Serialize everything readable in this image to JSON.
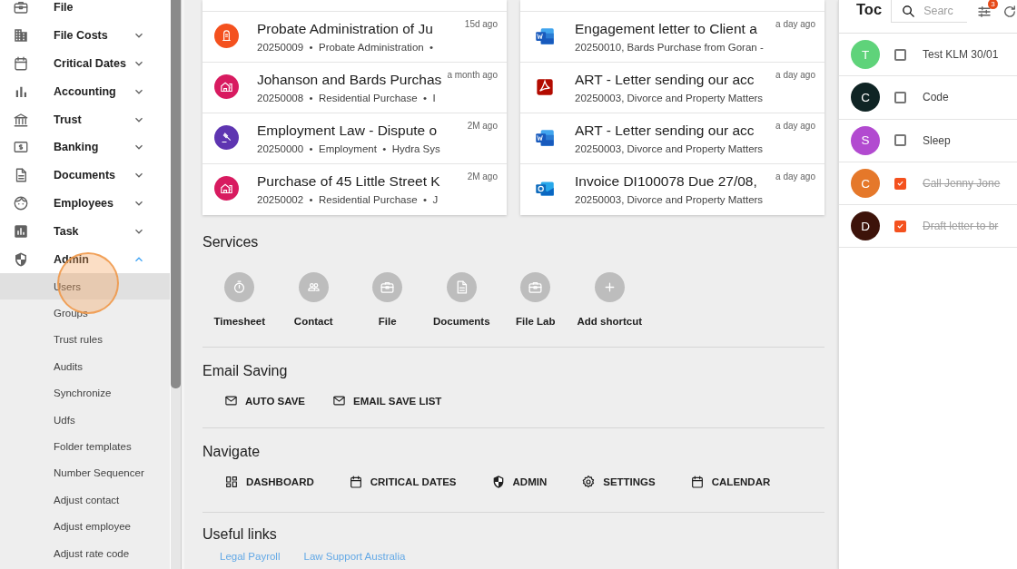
{
  "sidebar": {
    "items": [
      {
        "label": "File",
        "kind": "link"
      },
      {
        "label": "File Costs",
        "kind": "group",
        "expanded": false
      },
      {
        "label": "Critical Dates",
        "kind": "group",
        "expanded": false
      },
      {
        "label": "Accounting",
        "kind": "group",
        "expanded": false
      },
      {
        "label": "Trust",
        "kind": "group",
        "expanded": false
      },
      {
        "label": "Banking",
        "kind": "group",
        "expanded": false
      },
      {
        "label": "Documents",
        "kind": "group",
        "expanded": false
      },
      {
        "label": "Employees",
        "kind": "group",
        "expanded": false
      },
      {
        "label": "Task",
        "kind": "group",
        "expanded": false
      },
      {
        "label": "Admin",
        "kind": "group",
        "expanded": true,
        "children": [
          {
            "label": "Users",
            "selected": true
          },
          {
            "label": "Groups",
            "selected": false
          },
          {
            "label": "Trust rules",
            "selected": false
          },
          {
            "label": "Audits",
            "selected": false
          },
          {
            "label": "Synchronize",
            "selected": false
          },
          {
            "label": "Udfs",
            "selected": false
          },
          {
            "label": "Folder templates",
            "selected": false
          },
          {
            "label": "Number Sequencer",
            "selected": false
          },
          {
            "label": "Adjust contact",
            "selected": false
          },
          {
            "label": "Adjust employee",
            "selected": false
          },
          {
            "label": "Adjust rate code",
            "selected": false
          }
        ]
      }
    ]
  },
  "recent_files": [
    {
      "title": "Probate Administration of Ju",
      "time": "15d ago",
      "subtitle": "20250009  •  Probate Administration  •",
      "color": "#f4511e"
    },
    {
      "title": "Johanson and Bards Purchas",
      "time": "a month ago",
      "subtitle": "20250008  •  Residential Purchase  •  I",
      "color": "#d81b60"
    },
    {
      "title": "Employment Law - Dispute o",
      "time": "2M ago",
      "subtitle": "20250000  •  Employment  •  Hydra Sys",
      "color": "#5e35b1"
    },
    {
      "title": "Purchase of 45 Little Street K",
      "time": "2M ago",
      "subtitle": "20250002  •  Residential Purchase  •  J",
      "color": "#d81b60"
    }
  ],
  "recent_documents": [
    {
      "title": "Engagement letter to Client a",
      "time": "a day ago",
      "subtitle": "20250010, Bards Purchase from Goran -"
    },
    {
      "title": "ART - Letter sending our acc",
      "time": "a day ago",
      "subtitle": "20250003, Divorce and Property Matters"
    },
    {
      "title": "ART - Letter sending our acc",
      "time": "a day ago",
      "subtitle": "20250003, Divorce and Property Matters"
    },
    {
      "title": "Invoice DI100078 Due 27/08,",
      "time": "a day ago",
      "subtitle": "20250003, Divorce and Property Matters"
    }
  ],
  "services": {
    "title": "Services",
    "shortcuts": [
      "Timesheet",
      "Contact",
      "File",
      "Documents",
      "File Lab",
      "Add shortcut"
    ]
  },
  "email_saving": {
    "title": "Email Saving",
    "buttons": [
      "AUTO SAVE",
      "EMAIL SAVE LIST"
    ]
  },
  "navigate": {
    "title": "Navigate",
    "buttons": [
      "DASHBOARD",
      "CRITICAL DATES",
      "ADMIN",
      "SETTINGS",
      "CALENDAR"
    ]
  },
  "useful_links": {
    "title": "Useful links",
    "links": [
      "Legal Payroll",
      "Law Support Australia"
    ]
  },
  "todo": {
    "title": "Toc",
    "search": {
      "placeholder": "Searc"
    },
    "filter_badge": "3",
    "tasks": [
      {
        "initial": "T",
        "color": "#5fd37a",
        "checked": false,
        "text": "Test KLM 30/01"
      },
      {
        "initial": "C",
        "color": "#0f2424",
        "checked": false,
        "text": "Code"
      },
      {
        "initial": "S",
        "color": "#b24ad0",
        "checked": false,
        "text": "Sleep"
      },
      {
        "initial": "C",
        "color": "#e5782a",
        "checked": true,
        "text": "Call Jenny Jone"
      },
      {
        "initial": "D",
        "color": "#3d130a",
        "checked": true,
        "text": "Draft letter to br"
      }
    ]
  }
}
